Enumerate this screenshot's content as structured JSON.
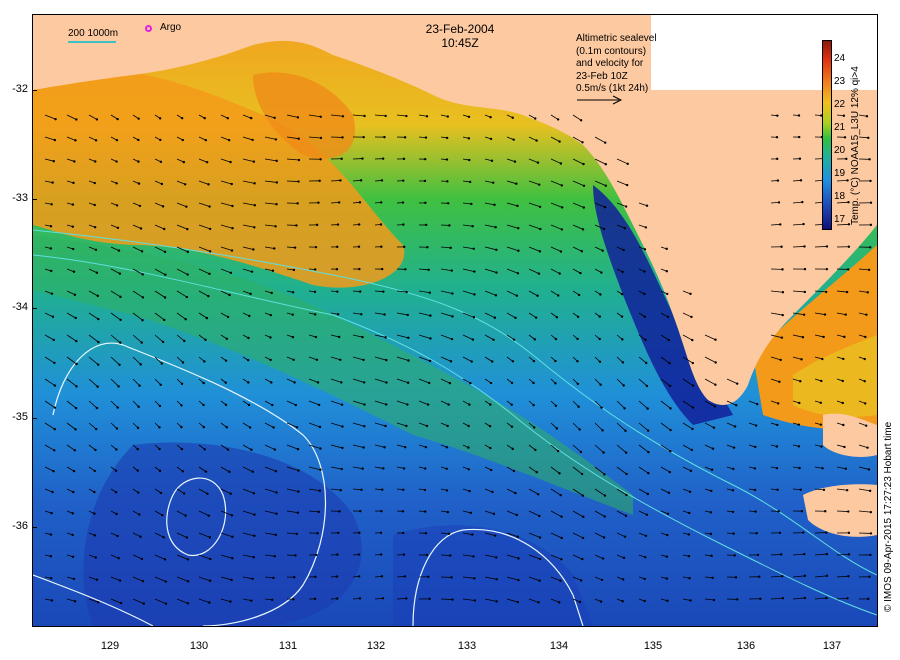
{
  "title": {
    "date": "23-Feb-2004",
    "time": "10:45Z"
  },
  "legend": {
    "scale_label": "200  1000m",
    "argo_label": "Argo",
    "altimetry_note": [
      "Altimetric sealevel",
      "(0.1m contours)",
      "and velocity for",
      "23-Feb 10Z",
      "0.5m/s (1kt 24h)"
    ]
  },
  "axes": {
    "x_ticks": [
      "129",
      "130",
      "131",
      "132",
      "133",
      "134",
      "135",
      "136",
      "137"
    ],
    "y_ticks": [
      "-32",
      "-33",
      "-34",
      "-35",
      "-36"
    ]
  },
  "colorbar": {
    "title": "Temp. (°C) NOAA15_L3U 12% qi>4",
    "labels": [
      "24",
      "23",
      "22",
      "21",
      "20",
      "19",
      "18",
      "17"
    ]
  },
  "credit": "© IMOS 09-Apr-2015 17:27:23 Hobart time",
  "colors": {
    "land": "#fdc9a0",
    "sea_warm": "#f39a1a",
    "sea_cold": "#1a38b8",
    "argo": "#e020e0"
  }
}
